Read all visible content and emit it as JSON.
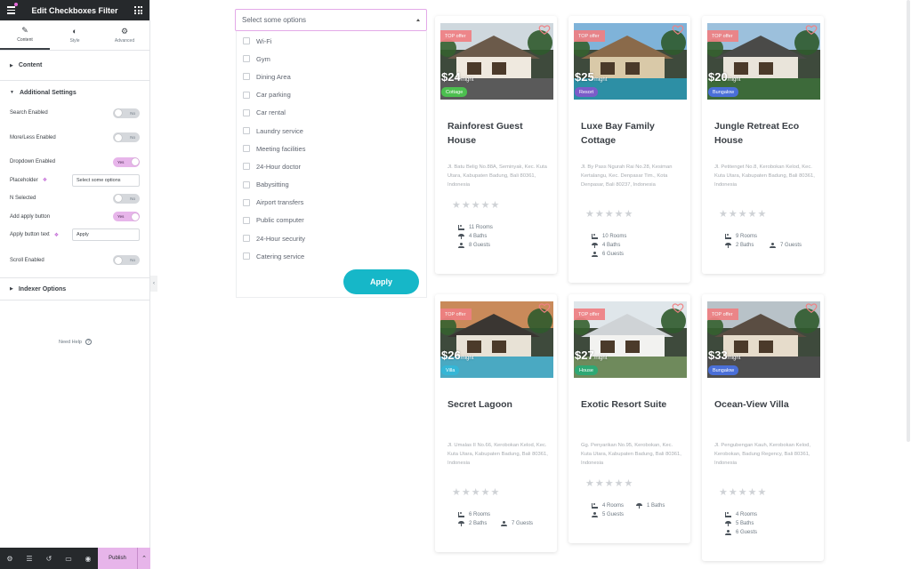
{
  "panel": {
    "title": "Edit Checkboxes Filter",
    "tabs": [
      {
        "label": "Content",
        "icon": "pencil-icon"
      },
      {
        "label": "Style",
        "icon": "half-circle-icon"
      },
      {
        "label": "Advanced",
        "icon": "gear-icon"
      }
    ],
    "sections": {
      "content": "Content",
      "additional": "Additional Settings",
      "indexer": "Indexer Options"
    },
    "controls": [
      {
        "label": "Search Enabled",
        "type": "toggle",
        "value": "No"
      },
      {
        "label": "More/Less Enabled",
        "type": "toggle",
        "value": "No"
      },
      {
        "label": "Dropdown Enabled",
        "type": "toggle",
        "value": "Yes"
      },
      {
        "label": "Placeholder",
        "type": "text",
        "value": "Select some options"
      },
      {
        "label": "N Selected",
        "type": "toggle",
        "value": "No"
      },
      {
        "label": "Add apply button",
        "type": "toggle",
        "value": "Yes"
      },
      {
        "label": "Apply button text",
        "type": "text",
        "value": "Apply"
      },
      {
        "label": "Scroll Enabled",
        "type": "toggle",
        "value": "No"
      }
    ],
    "need_help": "Need Help",
    "publish": "Publish"
  },
  "filter": {
    "placeholder": "Select some options",
    "options": [
      "Wi-Fi",
      "Gym",
      "Dining Area",
      "Car parking",
      "Car rental",
      "Laundry service",
      "Meeting facilities",
      "24-Hour doctor",
      "Babysitting",
      "Airport transfers",
      "Public computer",
      "24-Hour security",
      "Catering service"
    ],
    "apply_label": "Apply"
  },
  "colors": {
    "accent": "#16b7c8",
    "panel_dark": "#26292c",
    "publish": "#e7b5ea",
    "offer": "#f08083"
  },
  "cards": [
    {
      "offer": "TOP offer",
      "price": "$24",
      "per": "/night",
      "type": "Cottage",
      "type_color": "#4cbf4f",
      "name": "Rainforest Guest House",
      "address": "Jl. Batu Belig No.88A, Seminyak, Kec. Kuta Utara, Kabupaten Badung, Bali 80361, Indonesia",
      "rooms": "11 Rooms",
      "baths": "4 Baths",
      "guests": "8 Guests"
    },
    {
      "offer": "TOP offer",
      "price": "$25",
      "per": "/night",
      "type": "Resort",
      "type_color": "#7b5cc9",
      "name": "Luxe Bay Family Cottage",
      "address": "Jl. By Pass Ngurah Rai No.28, Kesiman Kertalangu, Kec. Denpasar Tim., Kota Denpasar, Bali 80237, Indonesia",
      "rooms": "10 Rooms",
      "baths": "4 Baths",
      "guests": "6 Guests"
    },
    {
      "offer": "TOP offer",
      "price": "$20",
      "per": "/night",
      "type": "Bungalow",
      "type_color": "#4a6fd8",
      "name": "Jungle Retreat Eco House",
      "address": "Jl. Petitenget No.8, Kerobokan Kelod, Kec. Kuta Utara, Kabupaten Badung, Bali 80361, Indonesia",
      "rooms": "9 Rooms",
      "baths": "2 Baths",
      "guests": "7 Guests"
    },
    {
      "offer": "TOP offer",
      "price": "$26",
      "per": "/night",
      "type": "Villa",
      "type_color": "#35b6d6",
      "name": "Secret Lagoon",
      "address": "Jl. Umalas II No.66, Kerobokan Kelod, Kec. Kuta Utara, Kabupaten Badung, Bali 80361, Indonesia",
      "rooms": "6 Rooms",
      "baths": "2 Baths",
      "guests": "7 Guests"
    },
    {
      "offer": "TOP offer",
      "price": "$27",
      "per": "/night",
      "type": "House",
      "type_color": "#2fa874",
      "name": "Exotic Resort Suite",
      "address": "Gg. Penyarikan No.95, Kerobokan, Kec. Kuta Utara, Kabupaten Badung, Bali 80361, Indonesia",
      "rooms": "4 Rooms",
      "baths": "1 Baths",
      "guests": "5 Guests"
    },
    {
      "offer": "TOP offer",
      "price": "$33",
      "per": "/night",
      "type": "Bungalow",
      "type_color": "#4a6fd8",
      "name": "Ocean-View Villa",
      "address": "Jl. Pengubengan Kauh, Kerobokan Kelod, Kerobokan, Badung Regency, Bali 80361, Indonesia",
      "rooms": "4 Rooms",
      "baths": "5 Baths",
      "guests": "6 Guests"
    }
  ]
}
